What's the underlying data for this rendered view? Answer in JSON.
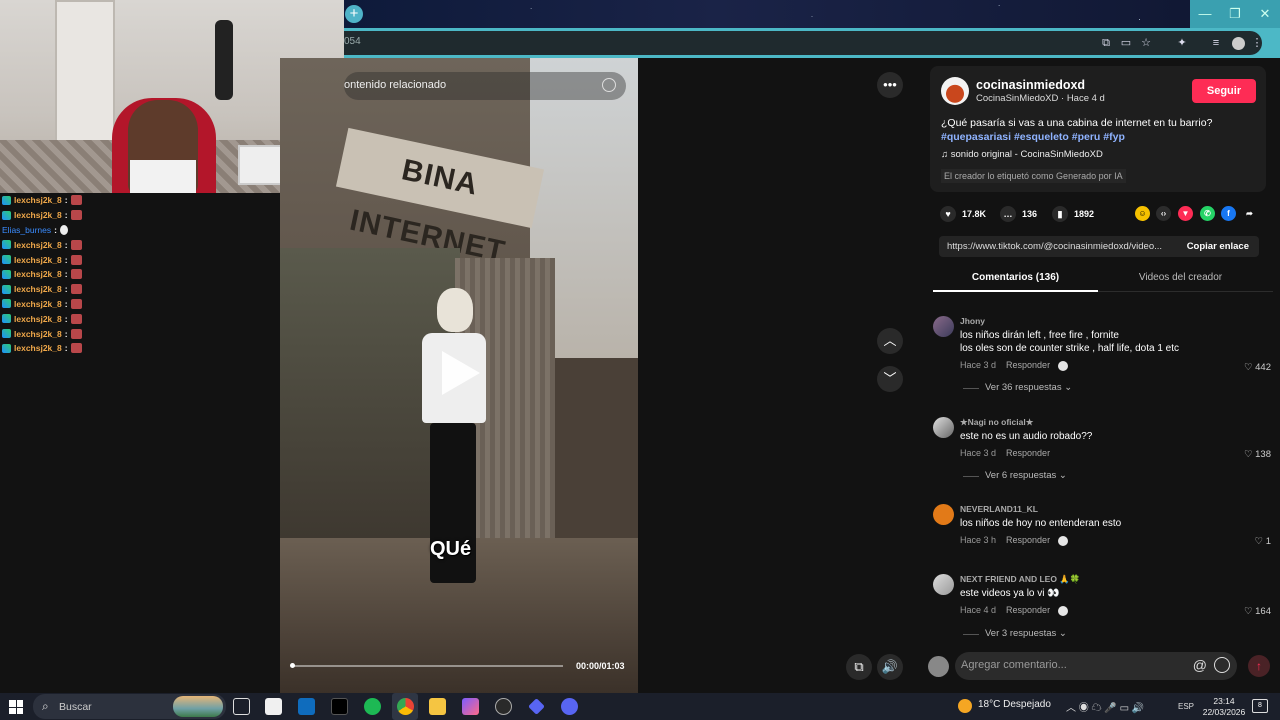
{
  "browser": {
    "url_fragment": "054",
    "new_tab_symbol": "+",
    "window_controls": [
      "—",
      "❐",
      "✕"
    ]
  },
  "chat": {
    "messages": [
      {
        "user": "lexchsj2k_8",
        "color": "orange"
      },
      {
        "user": "lexchsj2k_8",
        "color": "orange"
      },
      {
        "user": "Elias_burnes",
        "color": "blue"
      },
      {
        "user": "lexchsj2k_8",
        "color": "orange"
      },
      {
        "user": "lexchsj2k_8",
        "color": "orange"
      },
      {
        "user": "lexchsj2k_8",
        "color": "orange"
      },
      {
        "user": "lexchsj2k_8",
        "color": "orange"
      },
      {
        "user": "lexchsj2k_8",
        "color": "orange"
      },
      {
        "user": "lexchsj2k_8",
        "color": "orange"
      },
      {
        "user": "lexchsj2k_8",
        "color": "orange"
      },
      {
        "user": "lexchsj2k_8",
        "color": "orange"
      }
    ],
    "separator": ":"
  },
  "video": {
    "related_label": "ontenido relacionado",
    "sign_text": "BINA INTERNET",
    "caption": "QUé",
    "timecode": "00:00/01:03",
    "progress": 0.0
  },
  "post": {
    "author": "cocinasinmiedoxd",
    "author_display": "CocinaSinMiedoXD · Hace 4 d",
    "follow_label": "Seguir",
    "description": "¿Qué pasaría si vas a una cabina de internet en tu barrio?",
    "hashtags": [
      "#quepasariasi",
      "#esqueleto",
      "#peru",
      "#fyp"
    ],
    "sound": "sonido original - CocinaSinMiedoXD",
    "ai_label": "El creador lo etiquetó como Generado por IA",
    "likes": "17.8K",
    "comments": "136",
    "saves": "1892",
    "link": "https://www.tiktok.com/@cocinasinmiedoxd/video...",
    "copy_label": "Copiar enlace",
    "accent": "#fe2c55"
  },
  "tabs": {
    "comments_label": "Comentarios (136)",
    "videos_label": "Videos del creador"
  },
  "comments": [
    {
      "name": "Jhony",
      "lines": [
        "los niños dirán left , free fire , fornite",
        "los oles son de counter strike , half life, dota 1 etc"
      ],
      "time": "Hace 3 d",
      "reply": "Responder",
      "likes": "442",
      "more": "Ver 36 respuestas ⌄"
    },
    {
      "name": "★Nagi no oficial★",
      "lines": [
        "este no es un audio robado??"
      ],
      "time": "Hace 3 d",
      "reply": "Responder",
      "likes": "138",
      "more": "Ver 6 respuestas ⌄"
    },
    {
      "name": "NEVERLAND11_KL",
      "lines": [
        "los niños de hoy no entenderan esto"
      ],
      "time": "Hace 3 h",
      "reply": "Responder",
      "likes": "1",
      "more": ""
    },
    {
      "name": "NEXT FRIEND AND LEO 🙏🍀",
      "lines": [
        "este videos ya lo vi 👀"
      ],
      "time": "Hace 4 d",
      "reply": "Responder",
      "likes": "164",
      "more": "Ver 3 respuestas ⌄"
    }
  ],
  "composer": {
    "placeholder": "Agregar comentario...",
    "at": "@"
  },
  "taskbar": {
    "search_label": "Buscar",
    "weather": "18°C  Despejado",
    "lang": "ESP",
    "time": "23:14",
    "date": "22/03/2026",
    "notif_count": "8"
  }
}
